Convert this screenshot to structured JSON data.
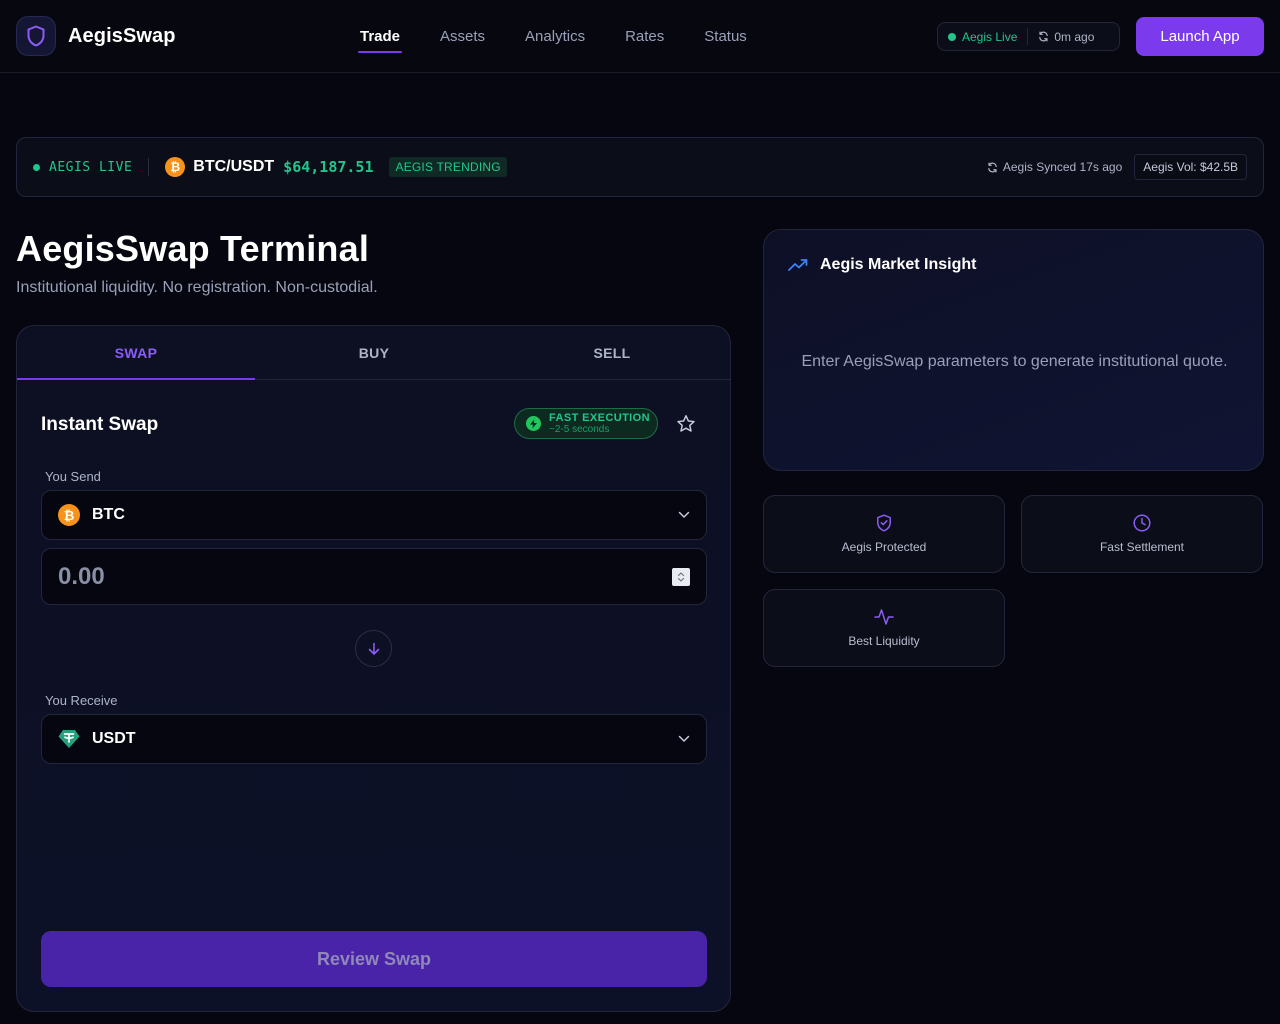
{
  "nav": {
    "brand": "AegisSwap",
    "links": [
      "Trade",
      "Assets",
      "Analytics",
      "Rates",
      "Status"
    ],
    "active_index": 0,
    "live_label": "Aegis Live",
    "updated": "0m ago",
    "launch_label": "Launch App"
  },
  "ticker": {
    "live": "AEGIS LIVE",
    "coin_glyph": "₿",
    "pair": "BTC/USDT",
    "price": "$64,187.51",
    "trending": "AEGIS TRENDING",
    "synced": "Aegis Synced 17s ago",
    "volume": "Aegis Vol: $42.5B"
  },
  "page": {
    "title": "AegisSwap Terminal",
    "subtitle": "Institutional liquidity. No registration. Non-custodial."
  },
  "swap": {
    "tabs": [
      "SWAP",
      "BUY",
      "SELL"
    ],
    "active_tab": 0,
    "title": "Instant Swap",
    "badge_title": "FAST EXECUTION",
    "badge_sub": "~2-5 seconds",
    "send_label": "You Send",
    "send_glyph": "₿",
    "send_symbol": "BTC",
    "amount_placeholder": "0.00",
    "receive_label": "You Receive",
    "receive_symbol": "USDT",
    "review_label": "Review Swap"
  },
  "insight": {
    "title": "Aegis Market Insight",
    "body": "Enter AegisSwap parameters to generate institutional quote."
  },
  "features": [
    {
      "label": "Aegis Protected",
      "icon": "shield-check-icon"
    },
    {
      "label": "Fast Settlement",
      "icon": "clock-icon"
    },
    {
      "label": "Best Liquidity",
      "icon": "activity-icon"
    }
  ],
  "colors": {
    "accent": "#7c3aed",
    "positive": "#22c58b",
    "btc": "#f7931a",
    "usdt": "#26a17b",
    "background": "#05060f"
  }
}
